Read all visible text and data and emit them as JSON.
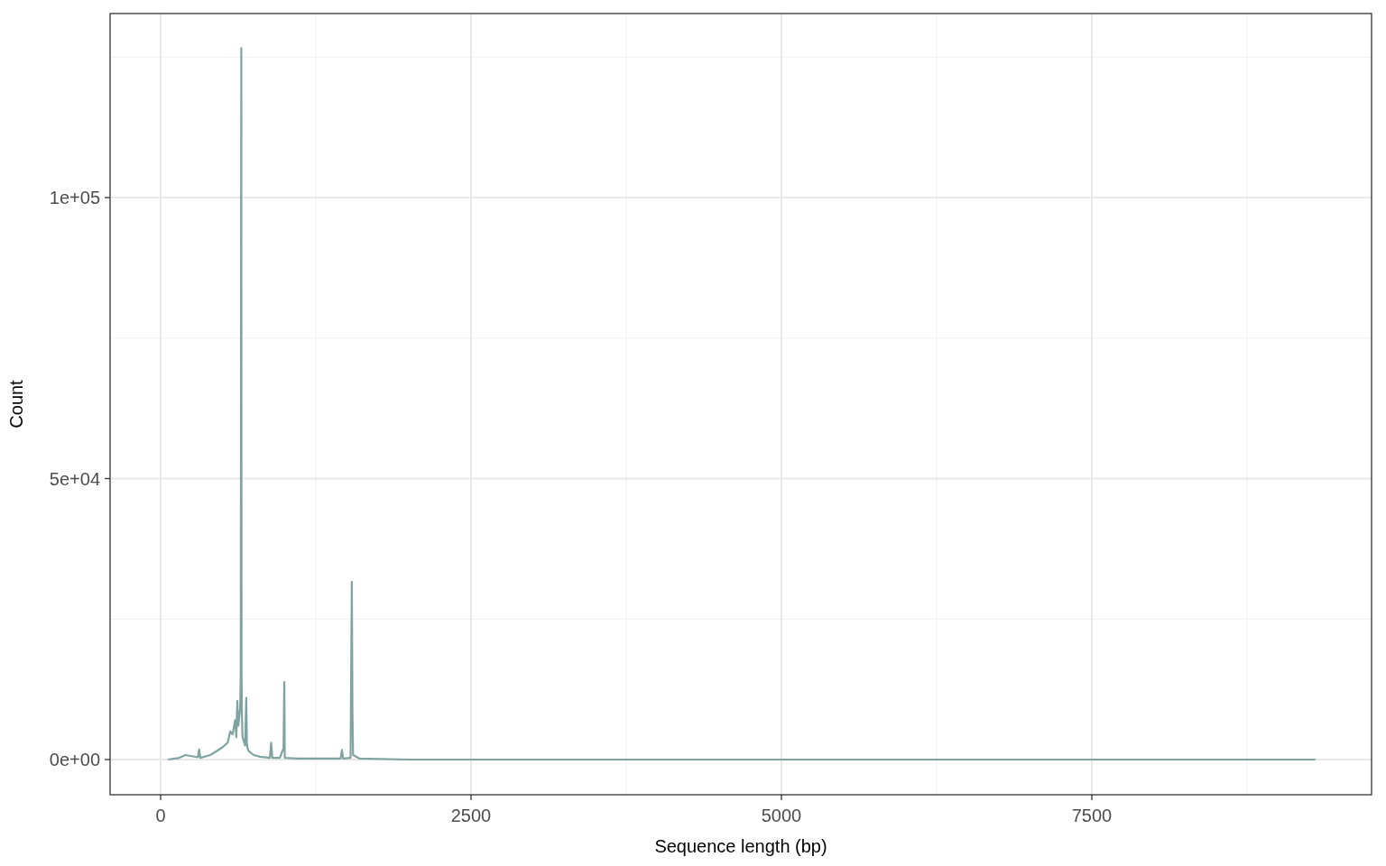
{
  "figure": {
    "chart_data": {
      "type": "line",
      "xlabel": "Sequence length (bp)",
      "ylabel": "Count",
      "x": [
        60,
        150,
        200,
        300,
        310,
        320,
        400,
        450,
        500,
        540,
        560,
        580,
        600,
        610,
        618,
        625,
        640,
        645,
        648,
        650,
        652,
        655,
        660,
        680,
        690,
        695,
        700,
        710,
        750,
        800,
        880,
        890,
        900,
        960,
        990,
        996,
        1000,
        1100,
        1450,
        1460,
        1470,
        1530,
        1540,
        1545,
        1550,
        1600,
        2000,
        5000,
        9300
      ],
      "grid": true,
      "series": [
        {
          "color": "#7fa3a1",
          "values": [
            0,
            300,
            800,
            400,
            1800,
            300,
            800,
            1500,
            2200,
            3000,
            5000,
            4500,
            7000,
            4000,
            10400,
            6000,
            9000,
            15000,
            90000,
            126600,
            15000,
            8000,
            4000,
            2500,
            11000,
            3000,
            2000,
            1500,
            800,
            500,
            300,
            3000,
            300,
            300,
            2000,
            13800,
            300,
            200,
            200,
            1700,
            200,
            300,
            31600,
            8500,
            800,
            200,
            0,
            0,
            0
          ]
        }
      ],
      "xlim": [
        -407,
        9753
      ],
      "ylim": [
        -6260,
        132745
      ],
      "xticks": [
        0,
        2500,
        5000,
        7500
      ],
      "yticks": [
        {
          "value": 0,
          "label": "0e+00"
        },
        {
          "value": 50000,
          "label": "5e+04"
        },
        {
          "value": 100000,
          "label": "1e+05"
        }
      ]
    }
  }
}
